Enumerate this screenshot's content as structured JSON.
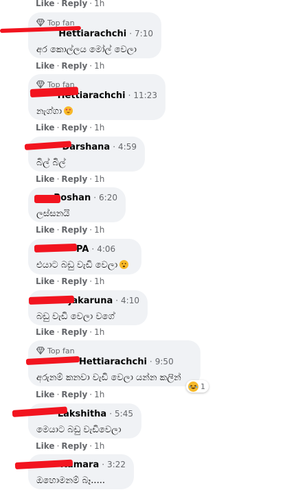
{
  "top_actions": {
    "like": "Like",
    "reply": "Reply",
    "time": "1h"
  },
  "comments": [
    {
      "badge": "Top fan",
      "author": "Hettiarachchi",
      "age": "7:10",
      "text": "අර කොල්ලය මෝල් වෙලා",
      "actions": {
        "like": "Like",
        "reply": "Reply",
        "time": "1h"
      }
    },
    {
      "badge": "Top fan",
      "author": "Hettiarachchi",
      "age": "11:23",
      "text": "නැග්ගා",
      "emoji": "heart-eyes",
      "actions": {
        "like": "Like",
        "reply": "Reply",
        "time": "1h"
      }
    },
    {
      "author": "Darshana",
      "age": "4:59",
      "text": "බිල් බිල්",
      "actions": {
        "like": "Like",
        "reply": "Reply",
        "time": "1h"
      }
    },
    {
      "author": "Roshan",
      "age": "6:20",
      "text": "ලස්සනයි",
      "actions": {
        "like": "Like",
        "reply": "Reply",
        "time": "1h"
      }
    },
    {
      "author": "PA",
      "age": "4:06",
      "text": "එයාට බඩු වැඩි වෙලා",
      "emoji": "sad-face",
      "actions": {
        "like": "Like",
        "reply": "Reply",
        "time": "1h"
      }
    },
    {
      "author": "Rajakaruna",
      "age": "4:10",
      "text": "බඩු වැඩි වෙලා වගේ",
      "actions": {
        "like": "Like",
        "reply": "Reply",
        "time": "1h"
      }
    },
    {
      "badge": "Top fan",
      "author": "Hettiarachchi",
      "age": "9:50",
      "text": "අරුනම් කනවා වැඩි වෙලා යන්න කලින්",
      "reaction": {
        "type": "laugh",
        "count": "1"
      },
      "actions": {
        "like": "Like",
        "reply": "Reply",
        "time": "1h"
      }
    },
    {
      "author": "Lakshitha",
      "age": "5:45",
      "text": "මෙයාට බඩු වැඩිවෙලා",
      "actions": {
        "like": "Like",
        "reply": "Reply",
        "time": "1h"
      }
    },
    {
      "author": "Kumara",
      "age": "3:22",
      "text": "ඔහොමනම් බෑ.....",
      "actions": {}
    }
  ],
  "colors": {
    "bubble": "#f0f2f5",
    "muted": "#65676b",
    "redaction": "#f2141f"
  }
}
